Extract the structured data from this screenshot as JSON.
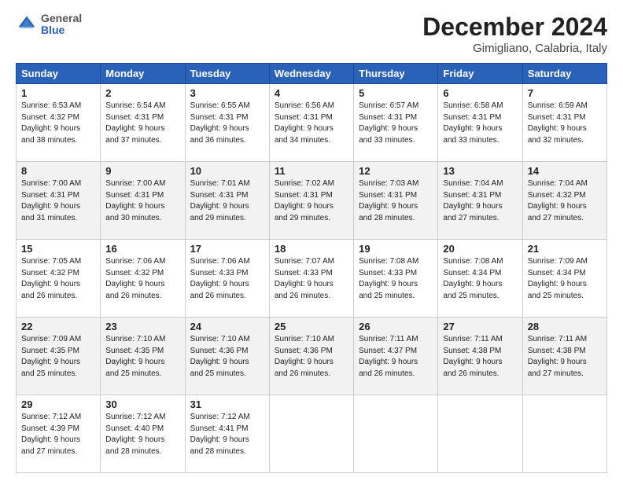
{
  "header": {
    "logo": {
      "general": "General",
      "blue": "Blue"
    },
    "title": "December 2024",
    "subtitle": "Gimigliano, Calabria, Italy"
  },
  "columns": [
    "Sunday",
    "Monday",
    "Tuesday",
    "Wednesday",
    "Thursday",
    "Friday",
    "Saturday"
  ],
  "weeks": [
    [
      {
        "day": "1",
        "info": "Sunrise: 6:53 AM\nSunset: 4:32 PM\nDaylight: 9 hours\nand 38 minutes."
      },
      {
        "day": "2",
        "info": "Sunrise: 6:54 AM\nSunset: 4:31 PM\nDaylight: 9 hours\nand 37 minutes."
      },
      {
        "day": "3",
        "info": "Sunrise: 6:55 AM\nSunset: 4:31 PM\nDaylight: 9 hours\nand 36 minutes."
      },
      {
        "day": "4",
        "info": "Sunrise: 6:56 AM\nSunset: 4:31 PM\nDaylight: 9 hours\nand 34 minutes."
      },
      {
        "day": "5",
        "info": "Sunrise: 6:57 AM\nSunset: 4:31 PM\nDaylight: 9 hours\nand 33 minutes."
      },
      {
        "day": "6",
        "info": "Sunrise: 6:58 AM\nSunset: 4:31 PM\nDaylight: 9 hours\nand 33 minutes."
      },
      {
        "day": "7",
        "info": "Sunrise: 6:59 AM\nSunset: 4:31 PM\nDaylight: 9 hours\nand 32 minutes."
      }
    ],
    [
      {
        "day": "8",
        "info": "Sunrise: 7:00 AM\nSunset: 4:31 PM\nDaylight: 9 hours\nand 31 minutes."
      },
      {
        "day": "9",
        "info": "Sunrise: 7:00 AM\nSunset: 4:31 PM\nDaylight: 9 hours\nand 30 minutes."
      },
      {
        "day": "10",
        "info": "Sunrise: 7:01 AM\nSunset: 4:31 PM\nDaylight: 9 hours\nand 29 minutes."
      },
      {
        "day": "11",
        "info": "Sunrise: 7:02 AM\nSunset: 4:31 PM\nDaylight: 9 hours\nand 29 minutes."
      },
      {
        "day": "12",
        "info": "Sunrise: 7:03 AM\nSunset: 4:31 PM\nDaylight: 9 hours\nand 28 minutes."
      },
      {
        "day": "13",
        "info": "Sunrise: 7:04 AM\nSunset: 4:31 PM\nDaylight: 9 hours\nand 27 minutes."
      },
      {
        "day": "14",
        "info": "Sunrise: 7:04 AM\nSunset: 4:32 PM\nDaylight: 9 hours\nand 27 minutes."
      }
    ],
    [
      {
        "day": "15",
        "info": "Sunrise: 7:05 AM\nSunset: 4:32 PM\nDaylight: 9 hours\nand 26 minutes."
      },
      {
        "day": "16",
        "info": "Sunrise: 7:06 AM\nSunset: 4:32 PM\nDaylight: 9 hours\nand 26 minutes."
      },
      {
        "day": "17",
        "info": "Sunrise: 7:06 AM\nSunset: 4:33 PM\nDaylight: 9 hours\nand 26 minutes."
      },
      {
        "day": "18",
        "info": "Sunrise: 7:07 AM\nSunset: 4:33 PM\nDaylight: 9 hours\nand 26 minutes."
      },
      {
        "day": "19",
        "info": "Sunrise: 7:08 AM\nSunset: 4:33 PM\nDaylight: 9 hours\nand 25 minutes."
      },
      {
        "day": "20",
        "info": "Sunrise: 7:08 AM\nSunset: 4:34 PM\nDaylight: 9 hours\nand 25 minutes."
      },
      {
        "day": "21",
        "info": "Sunrise: 7:09 AM\nSunset: 4:34 PM\nDaylight: 9 hours\nand 25 minutes."
      }
    ],
    [
      {
        "day": "22",
        "info": "Sunrise: 7:09 AM\nSunset: 4:35 PM\nDaylight: 9 hours\nand 25 minutes."
      },
      {
        "day": "23",
        "info": "Sunrise: 7:10 AM\nSunset: 4:35 PM\nDaylight: 9 hours\nand 25 minutes."
      },
      {
        "day": "24",
        "info": "Sunrise: 7:10 AM\nSunset: 4:36 PM\nDaylight: 9 hours\nand 25 minutes."
      },
      {
        "day": "25",
        "info": "Sunrise: 7:10 AM\nSunset: 4:36 PM\nDaylight: 9 hours\nand 26 minutes."
      },
      {
        "day": "26",
        "info": "Sunrise: 7:11 AM\nSunset: 4:37 PM\nDaylight: 9 hours\nand 26 minutes."
      },
      {
        "day": "27",
        "info": "Sunrise: 7:11 AM\nSunset: 4:38 PM\nDaylight: 9 hours\nand 26 minutes."
      },
      {
        "day": "28",
        "info": "Sunrise: 7:11 AM\nSunset: 4:38 PM\nDaylight: 9 hours\nand 27 minutes."
      }
    ],
    [
      {
        "day": "29",
        "info": "Sunrise: 7:12 AM\nSunset: 4:39 PM\nDaylight: 9 hours\nand 27 minutes."
      },
      {
        "day": "30",
        "info": "Sunrise: 7:12 AM\nSunset: 4:40 PM\nDaylight: 9 hours\nand 28 minutes."
      },
      {
        "day": "31",
        "info": "Sunrise: 7:12 AM\nSunset: 4:41 PM\nDaylight: 9 hours\nand 28 minutes."
      },
      null,
      null,
      null,
      null
    ]
  ]
}
